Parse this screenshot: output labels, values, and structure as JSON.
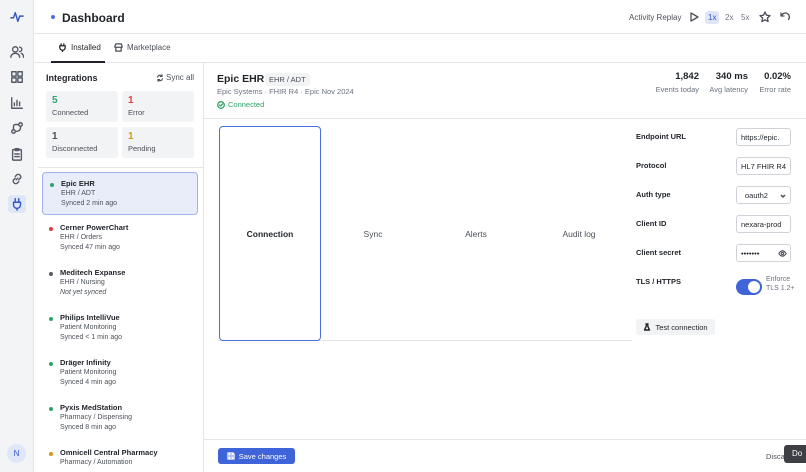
{
  "app": {
    "title": "Dashboard",
    "avatar_initial": "N",
    "dock_label": "Do"
  },
  "rail": {
    "icons": [
      "pulse-logo-icon",
      "users-icon",
      "grid-icon",
      "bar-chart-icon",
      "branch-icon",
      "clipboard-icon",
      "link-icon",
      "plug-icon"
    ],
    "active": "plug-icon"
  },
  "topbar": {
    "replay_label": "Activity Replay",
    "speeds": [
      "1x",
      "2x",
      "5x"
    ],
    "active_speed": "1x"
  },
  "tabs": {
    "installed": "Installed",
    "marketplace": "Marketplace"
  },
  "integrations": {
    "heading": "Integrations",
    "sync_all": "Sync all",
    "stats": [
      {
        "value": "5",
        "label": "Connected",
        "color": "#2ea36b"
      },
      {
        "value": "1",
        "label": "Error",
        "color": "#d9413b"
      },
      {
        "value": "1",
        "label": "Disconnected",
        "color": "#4b5058"
      },
      {
        "value": "1",
        "label": "Pending",
        "color": "#d49a16"
      }
    ],
    "items": [
      {
        "name": "Epic EHR",
        "type": "EHR / ADT",
        "sync": "Synced 2 min ago",
        "status_color": "#2ea36b",
        "italic": false
      },
      {
        "name": "Cerner PowerChart",
        "type": "EHR / Orders",
        "sync": "Synced 47 min ago",
        "status_color": "#d9413b",
        "italic": false
      },
      {
        "name": "Meditech Expanse",
        "type": "EHR / Nursing",
        "sync": "Not yet synced",
        "status_color": "#5b6068",
        "italic": true
      },
      {
        "name": "Philips IntelliVue",
        "type": "Patient Monitoring",
        "sync": "Synced < 1 min ago",
        "status_color": "#2ea36b",
        "italic": false
      },
      {
        "name": "Dräger Infinity",
        "type": "Patient Monitoring",
        "sync": "Synced 4 min ago",
        "status_color": "#2ea36b",
        "italic": false
      },
      {
        "name": "Pyxis MedStation",
        "type": "Pharmacy / Dispensing",
        "sync": "Synced 8 min ago",
        "status_color": "#2ea36b",
        "italic": false
      },
      {
        "name": "Omnicell Central Pharmacy",
        "type": "Pharmacy / Automation",
        "sync": "",
        "status_color": "#d49a16",
        "italic": false
      }
    ]
  },
  "detail": {
    "name": "Epic EHR",
    "tag": "EHR / ADT",
    "subtitle": "Epic Systems · FHIR R4 · Epic Nov 2024",
    "status": "Connected",
    "metrics": [
      {
        "value": "1,842",
        "label": "Events today"
      },
      {
        "value": "340 ms",
        "label": "Avg latency"
      },
      {
        "value": "0.02%",
        "label": "Error rate"
      }
    ],
    "tabs": [
      "Connection",
      "Sync",
      "Alerts",
      "Audit log"
    ],
    "active_tab": "Connection"
  },
  "form": {
    "endpoint_label": "Endpoint URL",
    "endpoint_value": "https://epic.",
    "protocol_label": "Protocol",
    "protocol_value": "HL7 FHIR R4",
    "auth_label": "Auth type",
    "auth_value": "oauth2",
    "client_id_label": "Client ID",
    "client_id_value": "nexara-prod",
    "secret_label": "Client secret",
    "secret_value": "•••••••",
    "tls_label": "TLS / HTTPS",
    "tls_note": "Enforce TLS 1.2+",
    "tls_enabled": true,
    "test_button": "Test connection"
  },
  "footer": {
    "save": "Save changes",
    "discard": "Disca"
  }
}
